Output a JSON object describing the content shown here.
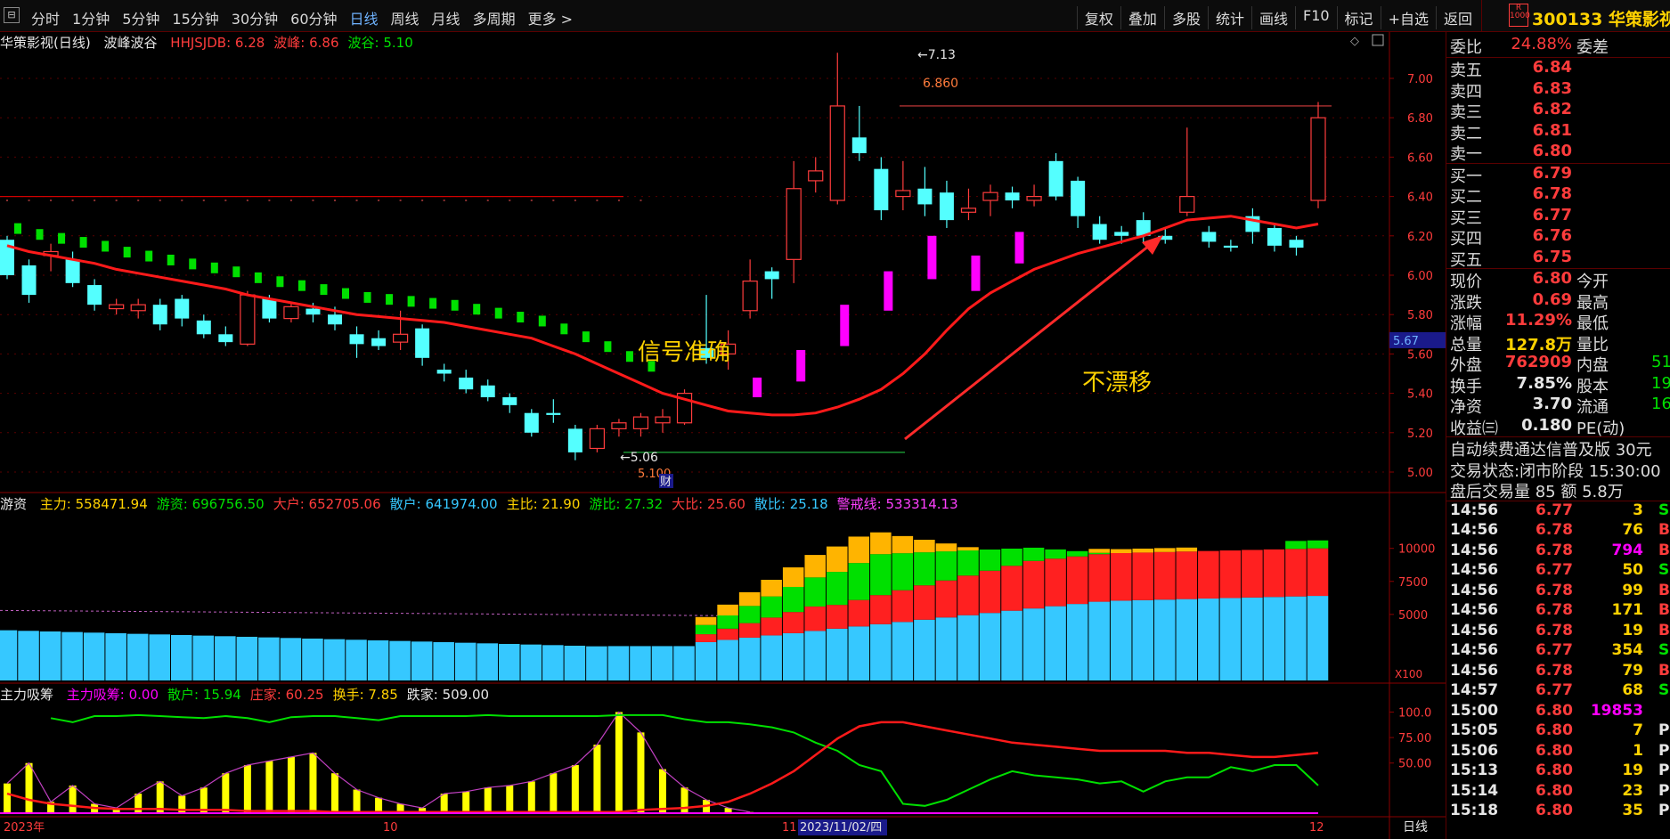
{
  "toolbar": {
    "periods": [
      "分时",
      "1分钟",
      "5分钟",
      "15分钟",
      "30分钟",
      "60分钟",
      "日线",
      "周线",
      "月线",
      "多周期",
      "更多 >"
    ],
    "active_period": "日线",
    "actions": [
      "复权",
      "叠加",
      "多股",
      "统计",
      "画线",
      "F10",
      "标记",
      "+自选",
      "返回"
    ]
  },
  "stock": {
    "badge": "R\n1000",
    "code_name": "300133 华策影视"
  },
  "main_panel": {
    "title": "华策影视(日线)",
    "indicator": "波峰波谷",
    "legend": [
      {
        "text": "HHJSJDB: 6.28",
        "color": "#ff3c3c"
      },
      {
        "text": "波峰: 6.86",
        "color": "#ff3c3c"
      },
      {
        "text": "波谷: 5.10",
        "color": "#00e000"
      }
    ],
    "y_ticks": [
      "7.00",
      "6.80",
      "6.60",
      "6.40",
      "6.20",
      "6.00",
      "5.80",
      "5.60",
      "5.40",
      "5.20",
      "5.00"
    ],
    "current_price_tag": "5.67",
    "high_label": "7.13",
    "peak_label": "6.860",
    "low_label": "5.06",
    "low_label2": "5.100",
    "finance_tag": "财",
    "annotation1": "信号准确",
    "annotation2": "不漂移"
  },
  "sub_panel1": {
    "title": "游资",
    "legend": [
      {
        "text": "主力: 558471.94",
        "color": "#ffd200"
      },
      {
        "text": "游资: 696756.50",
        "color": "#00e000"
      },
      {
        "text": "大户: 652705.06",
        "color": "#ff3c3c"
      },
      {
        "text": "散户: 641974.00",
        "color": "#36c8ff"
      },
      {
        "text": "主比: 21.90",
        "color": "#ffd200"
      },
      {
        "text": "游比: 27.32",
        "color": "#00e000"
      },
      {
        "text": "大比: 25.60",
        "color": "#ff3c3c"
      },
      {
        "text": "散比: 25.18",
        "color": "#36c8ff"
      },
      {
        "text": "警戒线: 533314.13",
        "color": "#ff40ff"
      }
    ],
    "y_ticks": [
      "10000",
      "7500",
      "5000"
    ],
    "scale_tag": "X100"
  },
  "sub_panel2": {
    "title": "主力吸筹",
    "legend": [
      {
        "text": "主力吸筹: 0.00",
        "color": "#ff00ff"
      },
      {
        "text": "散户: 15.94",
        "color": "#00e000"
      },
      {
        "text": "庄家: 60.25",
        "color": "#ff3c3c"
      },
      {
        "text": "换手: 7.85",
        "color": "#ffd200"
      },
      {
        "text": "跌家: 509.00",
        "color": "#e6e6e6"
      }
    ],
    "y_ticks": [
      "100.0",
      "75.00",
      "50.00"
    ]
  },
  "x_axis": {
    "labels": [
      "2023年",
      "10",
      "11",
      "2023/11/02/四",
      "12"
    ],
    "period_label": "日线"
  },
  "quote": {
    "weibi_label": "委比",
    "weibi": "24.88%",
    "weicha_label": "委差",
    "asks": [
      {
        "label": "卖五",
        "price": "6.84"
      },
      {
        "label": "卖四",
        "price": "6.83"
      },
      {
        "label": "卖三",
        "price": "6.82"
      },
      {
        "label": "卖二",
        "price": "6.81"
      },
      {
        "label": "卖一",
        "price": "6.80"
      }
    ],
    "bids": [
      {
        "label": "买一",
        "price": "6.79"
      },
      {
        "label": "买二",
        "price": "6.78"
      },
      {
        "label": "买三",
        "price": "6.77"
      },
      {
        "label": "买四",
        "price": "6.76"
      },
      {
        "label": "买五",
        "price": "6.75"
      }
    ],
    "stats": [
      {
        "l": "现价",
        "v": "6.80",
        "c": "red",
        "l2": "今开",
        "v2": ""
      },
      {
        "l": "涨跌",
        "v": "0.69",
        "c": "red",
        "l2": "最高",
        "v2": ""
      },
      {
        "l": "涨幅",
        "v": "11.29%",
        "c": "red",
        "l2": "最低",
        "v2": ""
      },
      {
        "l": "总量",
        "v": "127.8万",
        "c": "yellow",
        "l2": "量比",
        "v2": ""
      },
      {
        "l": "外盘",
        "v": "762909",
        "c": "red",
        "l2": "内盘",
        "v2": "51"
      },
      {
        "l": "换手",
        "v": "7.85%",
        "c": "white",
        "l2": "股本",
        "v2": "19"
      },
      {
        "l": "净资",
        "v": "3.70",
        "c": "white",
        "l2": "流通",
        "v2": "16"
      },
      {
        "l": "收益㈢",
        "v": "0.180",
        "c": "white",
        "l2": "PE(动)",
        "v2": ""
      }
    ],
    "notice1": "自动续费通达信普及版 30元",
    "notice2": "交易状态:闭市阶段 15:30:00",
    "notice3": "盘后交易量 85 额 5.8万",
    "ticks": [
      {
        "t": "14:56",
        "p": "6.77",
        "q": "3",
        "s": "S",
        "qc": "#ffd200",
        "sc": "#00e000"
      },
      {
        "t": "14:56",
        "p": "6.78",
        "q": "76",
        "s": "B",
        "qc": "#ffd200",
        "sc": "#ff3c3c"
      },
      {
        "t": "14:56",
        "p": "6.78",
        "q": "794",
        "s": "B",
        "qc": "#ff00ff",
        "sc": "#ff3c3c"
      },
      {
        "t": "14:56",
        "p": "6.77",
        "q": "50",
        "s": "S",
        "qc": "#ffd200",
        "sc": "#00e000"
      },
      {
        "t": "14:56",
        "p": "6.78",
        "q": "99",
        "s": "B",
        "qc": "#ffd200",
        "sc": "#ff3c3c"
      },
      {
        "t": "14:56",
        "p": "6.78",
        "q": "171",
        "s": "B",
        "qc": "#ffd200",
        "sc": "#ff3c3c"
      },
      {
        "t": "14:56",
        "p": "6.78",
        "q": "19",
        "s": "B",
        "qc": "#ffd200",
        "sc": "#ff3c3c"
      },
      {
        "t": "14:56",
        "p": "6.77",
        "q": "354",
        "s": "S",
        "qc": "#ffd200",
        "sc": "#00e000"
      },
      {
        "t": "14:56",
        "p": "6.78",
        "q": "79",
        "s": "B",
        "qc": "#ffd200",
        "sc": "#ff3c3c"
      },
      {
        "t": "14:57",
        "p": "6.77",
        "q": "68",
        "s": "S",
        "qc": "#ffd200",
        "sc": "#00e000"
      },
      {
        "t": "15:00",
        "p": "6.80",
        "q": "19853",
        "s": "",
        "qc": "#ff00ff",
        "sc": "#ff3c3c"
      },
      {
        "t": "15:05",
        "p": "6.80",
        "q": "7",
        "s": "P",
        "qc": "#ffd200",
        "sc": "#e6e6e6"
      },
      {
        "t": "15:06",
        "p": "6.80",
        "q": "1",
        "s": "P",
        "qc": "#ffd200",
        "sc": "#e6e6e6"
      },
      {
        "t": "15:13",
        "p": "6.80",
        "q": "19",
        "s": "P",
        "qc": "#ffd200",
        "sc": "#e6e6e6"
      },
      {
        "t": "15:14",
        "p": "6.80",
        "q": "23",
        "s": "P",
        "qc": "#ffd200",
        "sc": "#e6e6e6"
      },
      {
        "t": "15:18",
        "p": "6.80",
        "q": "35",
        "s": "P",
        "qc": "#ffd200",
        "sc": "#e6e6e6"
      }
    ]
  },
  "chart_data": [
    {
      "type": "candlestick",
      "title": "华策影视(日线)",
      "ylim": [
        4.95,
        7.15
      ],
      "ma": [
        6.15,
        6.12,
        6.1,
        6.08,
        6.06,
        6.03,
        6.01,
        5.99,
        5.97,
        5.95,
        5.93,
        5.9,
        5.88,
        5.86,
        5.84,
        5.82,
        5.8,
        5.79,
        5.78,
        5.77,
        5.76,
        5.74,
        5.72,
        5.7,
        5.68,
        5.64,
        5.6,
        5.55,
        5.5,
        5.45,
        5.4,
        5.37,
        5.34,
        5.31,
        5.3,
        5.29,
        5.29,
        5.3,
        5.33,
        5.37,
        5.42,
        5.5,
        5.6,
        5.72,
        5.83,
        5.91,
        5.97,
        6.03,
        6.07,
        6.11,
        6.14,
        6.17,
        6.2,
        6.24,
        6.28,
        6.29,
        6.3,
        6.28,
        6.26,
        6.24,
        6.26
      ],
      "candles": [
        [
          6.18,
          6.0,
          6.2,
          5.98
        ],
        [
          6.05,
          5.9,
          6.08,
          5.86
        ],
        [
          6.1,
          6.12,
          6.16,
          6.02
        ],
        [
          6.08,
          5.96,
          6.12,
          5.94
        ],
        [
          5.95,
          5.85,
          5.98,
          5.82
        ],
        [
          5.83,
          5.85,
          5.88,
          5.8
        ],
        [
          5.82,
          5.85,
          5.88,
          5.78
        ],
        [
          5.85,
          5.75,
          5.88,
          5.72
        ],
        [
          5.88,
          5.78,
          5.9,
          5.74
        ],
        [
          5.77,
          5.7,
          5.8,
          5.68
        ],
        [
          5.7,
          5.66,
          5.74,
          5.64
        ],
        [
          5.65,
          5.9,
          5.92,
          5.64
        ],
        [
          5.88,
          5.78,
          5.9,
          5.76
        ],
        [
          5.78,
          5.84,
          5.86,
          5.76
        ],
        [
          5.83,
          5.8,
          5.86,
          5.76
        ],
        [
          5.8,
          5.75,
          5.84,
          5.72
        ],
        [
          5.7,
          5.65,
          5.74,
          5.58
        ],
        [
          5.68,
          5.64,
          5.72,
          5.62
        ],
        [
          5.66,
          5.7,
          5.82,
          5.62
        ],
        [
          5.73,
          5.58,
          5.75,
          5.54
        ],
        [
          5.52,
          5.5,
          5.55,
          5.46
        ],
        [
          5.48,
          5.42,
          5.52,
          5.4
        ],
        [
          5.44,
          5.38,
          5.47,
          5.36
        ],
        [
          5.38,
          5.34,
          5.4,
          5.3
        ],
        [
          5.3,
          5.2,
          5.32,
          5.18
        ],
        [
          5.3,
          5.29,
          5.37,
          5.25
        ],
        [
          5.22,
          5.1,
          5.24,
          5.06
        ],
        [
          5.12,
          5.22,
          5.24,
          5.1
        ],
        [
          5.22,
          5.25,
          5.27,
          5.18
        ],
        [
          5.22,
          5.28,
          5.3,
          5.18
        ],
        [
          5.25,
          5.28,
          5.32,
          5.2
        ],
        [
          5.25,
          5.4,
          5.42,
          5.24
        ],
        [
          5.63,
          5.58,
          5.9,
          5.55
        ],
        [
          5.6,
          5.65,
          5.72,
          5.52
        ],
        [
          5.82,
          5.97,
          6.08,
          5.78
        ],
        [
          6.02,
          5.98,
          6.04,
          5.88
        ],
        [
          6.08,
          6.44,
          6.58,
          5.96
        ],
        [
          6.48,
          6.53,
          6.6,
          6.42
        ],
        [
          6.38,
          6.86,
          7.13,
          6.36
        ],
        [
          6.7,
          6.62,
          6.86,
          6.58
        ],
        [
          6.54,
          6.33,
          6.6,
          6.28
        ],
        [
          6.4,
          6.43,
          6.58,
          6.33
        ],
        [
          6.44,
          6.36,
          6.55,
          6.3
        ],
        [
          6.42,
          6.28,
          6.48,
          6.24
        ],
        [
          6.32,
          6.34,
          6.44,
          6.28
        ],
        [
          6.38,
          6.42,
          6.46,
          6.3
        ],
        [
          6.42,
          6.38,
          6.45,
          6.34
        ],
        [
          6.38,
          6.4,
          6.46,
          6.35
        ],
        [
          6.58,
          6.4,
          6.62,
          6.38
        ],
        [
          6.48,
          6.3,
          6.5,
          6.24
        ],
        [
          6.26,
          6.18,
          6.3,
          6.16
        ],
        [
          6.22,
          6.2,
          6.25,
          6.16
        ],
        [
          6.28,
          6.2,
          6.32,
          6.16
        ],
        [
          6.2,
          6.18,
          6.24,
          6.16
        ],
        [
          6.32,
          6.4,
          6.75,
          6.3
        ],
        [
          6.22,
          6.17,
          6.25,
          6.14
        ],
        [
          6.15,
          6.14,
          6.18,
          6.12
        ],
        [
          6.3,
          6.22,
          6.34,
          6.16
        ],
        [
          6.24,
          6.15,
          6.26,
          6.12
        ],
        [
          6.18,
          6.14,
          6.2,
          6.1
        ],
        [
          6.38,
          6.8,
          6.88,
          6.34
        ]
      ]
    }
  ]
}
